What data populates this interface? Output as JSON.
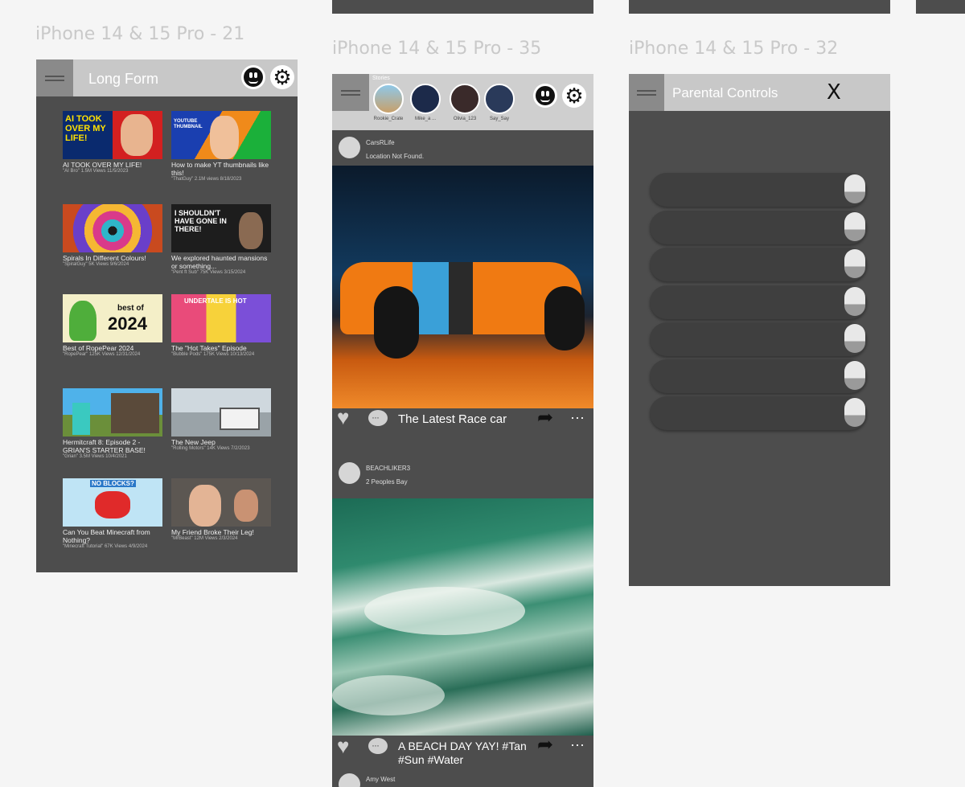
{
  "frames": [
    {
      "label": "iPhone 14 & 15 Pro - 21"
    },
    {
      "label": "iPhone 14 & 15 Pro - 35"
    },
    {
      "label": "iPhone 14 & 15 Pro - 32"
    }
  ],
  "long_form": {
    "title": "Long Form",
    "videos": [
      {
        "title": "AI TOOK OVER MY LIFE!",
        "meta": "\"AI Bro\" 1.5M Views 11/5/2023"
      },
      {
        "title": "How to make YT thumbnails like this!",
        "meta": "\"ThatGuy\" 2.1M views 8/18/2023"
      },
      {
        "title": "Spirals In Different Colours!",
        "meta": "\"SpiralGuy\" 5K Views 9/6/2024"
      },
      {
        "title": "We explored haunted mansions or something...",
        "meta": "\"Pent ft Sub\" 75K Views 3/15/2024"
      },
      {
        "title": "Best of RopePear 2024",
        "meta": "\"RopePear\" 125K Views 12/31/2024"
      },
      {
        "title": "The \"Hot Takes\" Episode",
        "meta": "\"Bubble Pods\" 175K Views 10/13/2024"
      },
      {
        "title": "Hermitcraft 8: Episode 2 - GRIAN'S STARTER BASE!",
        "meta": "\"Grian\" 3.5M Views 10/4/2021"
      },
      {
        "title": "The New Jeep",
        "meta": "\"Rolling Motors\" 14K Views 7/2/2023"
      },
      {
        "title": "Can You Beat Minecraft from Nothing?",
        "meta": "\"Minecraft Tutorial\" 67K Views 4/9/2024"
      },
      {
        "title": "My Friend Broke Their Leg!",
        "meta": "\"MrBeast\" 12M Views 2/3/2024"
      }
    ],
    "thumb_text": {
      "ai": "AI TOOK OVER MY LIFE!",
      "yt": "YOUTUBE THUMBNAIL",
      "haunt": "I SHOULDN'T HAVE GONE IN THERE!",
      "best_small": "best of",
      "best_big": "2024",
      "hot": "UNDERTALE IS HOT",
      "nodiff": "NO BLOCKS?"
    }
  },
  "feed": {
    "stories_label": "Stories",
    "stories": [
      {
        "name": "Rookie_Crate"
      },
      {
        "name": "Mike_a ..."
      },
      {
        "name": "Olivia_123"
      },
      {
        "name": "Say_Say"
      }
    ],
    "posts": [
      {
        "user": "CarsRLife",
        "location": "Location Not Found.",
        "caption": "The Latest Race car"
      },
      {
        "user": "BEACHLIKER3",
        "location": "2 Peoples Bay",
        "caption": "A BEACH DAY YAY! #Tan #Sun #Water"
      }
    ],
    "third_user": "Amy West"
  },
  "parental": {
    "title": "Parental Controls",
    "close_label": "X",
    "toggles": [
      1,
      1,
      1,
      1,
      1,
      1,
      1
    ]
  },
  "colors": {
    "frame_bg": "#4d4d4d",
    "header_bg": "#c8c8c8",
    "canvas_bg": "#f5f5f5"
  }
}
